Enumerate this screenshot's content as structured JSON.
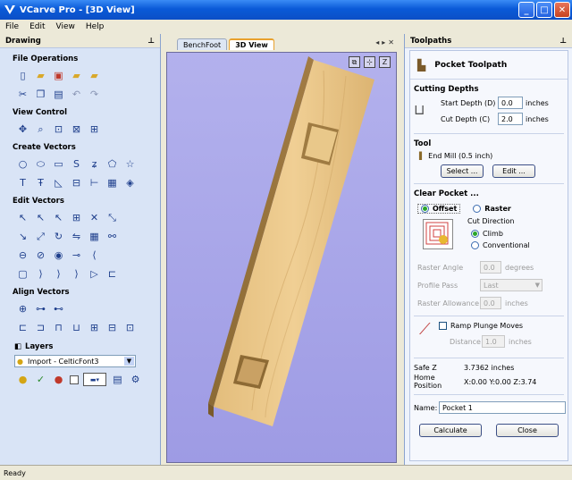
{
  "window": {
    "title": "VCarve Pro - [3D View]"
  },
  "menu": [
    "File",
    "Edit",
    "View",
    "Help"
  ],
  "drawing_panel": {
    "title": "Drawing",
    "sections": {
      "file_ops": "File Operations",
      "view_ctrl": "View Control",
      "create_vectors": "Create Vectors",
      "edit_vectors": "Edit Vectors",
      "align_vectors": "Align Vectors",
      "layers": "Layers"
    },
    "layer_selected": "Import - CelticFont3"
  },
  "viewport": {
    "tabs": [
      "BenchFoot",
      "3D View"
    ],
    "active_tab": "3D View"
  },
  "toolpaths_panel": {
    "title": "Toolpaths",
    "heading": "Pocket Toolpath",
    "cutting_depths": {
      "title": "Cutting Depths",
      "start_label": "Start Depth (D)",
      "start_value": "0.0",
      "cut_label": "Cut Depth (C)",
      "cut_value": "2.0",
      "unit": "inches"
    },
    "tool": {
      "title": "Tool",
      "name": "End Mill (0.5 inch)",
      "select_label": "Select ...",
      "edit_label": "Edit ..."
    },
    "clear_pocket": {
      "title": "Clear Pocket ...",
      "offset_label": "Offset",
      "raster_label": "Raster",
      "cut_direction_label": "Cut Direction",
      "climb_label": "Climb",
      "conventional_label": "Conventional",
      "raster_angle_label": "Raster Angle",
      "raster_angle_value": "0.0",
      "raster_angle_unit": "degrees",
      "profile_pass_label": "Profile Pass",
      "profile_pass_value": "Last",
      "raster_allowance_label": "Raster Allowance",
      "raster_allowance_value": "0.0",
      "raster_allowance_unit": "inches"
    },
    "ramp": {
      "label": "Ramp Plunge Moves",
      "distance_label": "Distance",
      "distance_value": "1.0",
      "distance_unit": "inches"
    },
    "safe_z_label": "Safe Z",
    "safe_z_value": "3.7362 inches",
    "home_label": "Home Position",
    "home_value": "X:0.00 Y:0.00 Z:3.74",
    "name_label": "Name:",
    "name_value": "Pocket 1",
    "calculate_label": "Calculate",
    "close_label": "Close"
  },
  "status": "Ready"
}
